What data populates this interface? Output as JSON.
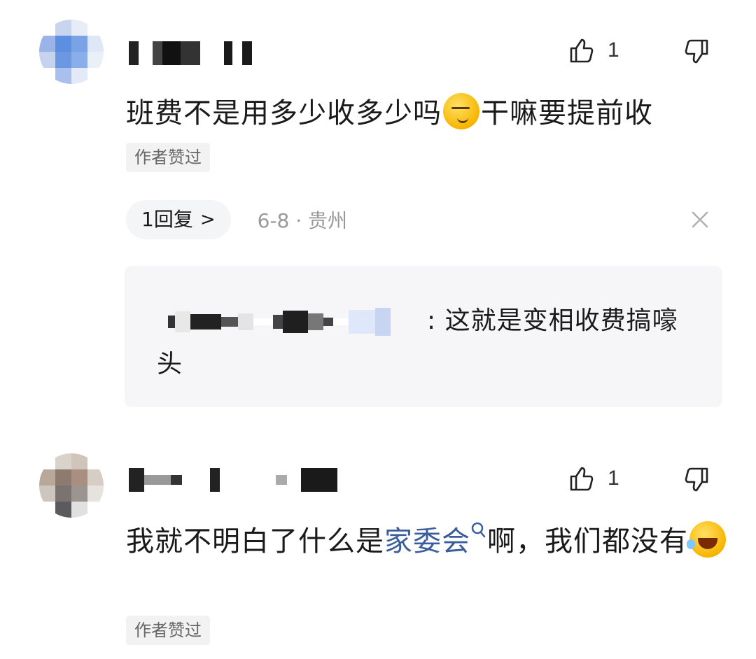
{
  "comments": [
    {
      "likes": "1",
      "text": "班费不是用多少收多少吗",
      "text_after_emoji": "干嘛要提前收",
      "emoji": "smirk-emoji",
      "badge": "作者赞过",
      "reply_button": "1回复",
      "reply_chevron": ">",
      "meta": "6-8 · 贵州",
      "reply_preview": ": 这就是变相收费搞嚎头"
    },
    {
      "likes": "1",
      "text_before_link": "我就不明白了什么是",
      "link": "家委会",
      "text_after_link": "啊，我们都没有",
      "emoji": "laughing-tears-emoji",
      "badge": "作者赞过"
    }
  ],
  "colors": {
    "link": "#3a5d9c",
    "badge_bg": "#f2f2f2",
    "reply_box_bg": "#f6f6f8",
    "meta_text": "#999999"
  },
  "icons": {
    "like": "thumbs-up-outline-icon",
    "dislike": "thumbs-down-outline-icon",
    "close": "close-icon",
    "search": "search-icon"
  }
}
